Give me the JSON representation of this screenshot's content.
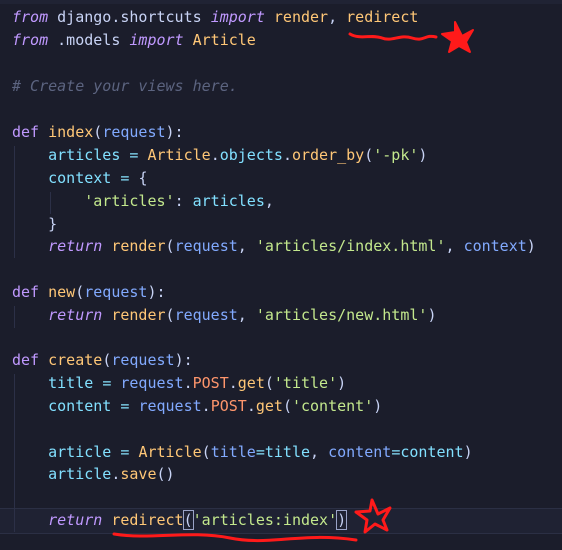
{
  "editor": {
    "lines": {
      "l1": {
        "from": "from",
        "mod": "django.shortcuts",
        "import": "import",
        "a": "render",
        "comma": ",",
        "b": "redirect"
      },
      "l2": {
        "from": "from",
        "mod": ".models",
        "import": "import",
        "a": "Article"
      },
      "l3": {
        "comment": "# Create your views here."
      },
      "l4": {
        "def": "def",
        "name": "index",
        "open": "(",
        "param": "request",
        "close": "):"
      },
      "l5": {
        "var": "articles",
        "eq": "=",
        "cls": "Article",
        "dot1": ".",
        "objects": "objects",
        "dot2": ".",
        "meth": "order_by",
        "open": "(",
        "str": "'-pk'",
        "close": ")"
      },
      "l6": {
        "var": "context",
        "eq": "=",
        "brace": "{"
      },
      "l7": {
        "key": "'articles'",
        "colon": ":",
        "val": "articles",
        "comma": ","
      },
      "l8": {
        "brace": "}"
      },
      "l9": {
        "ret": "return",
        "fn": "render",
        "open": "(",
        "p1": "request",
        "c1": ",",
        "s": "'articles/index.html'",
        "c2": ",",
        "p2": "context",
        "close": ")"
      },
      "l10": {
        "def": "def",
        "name": "new",
        "open": "(",
        "param": "request",
        "close": "):"
      },
      "l11": {
        "ret": "return",
        "fn": "render",
        "open": "(",
        "p1": "request",
        "c1": ",",
        "s": "'articles/new.html'",
        "close": ")"
      },
      "l12": {
        "def": "def",
        "name": "create",
        "open": "(",
        "param": "request",
        "close": "):"
      },
      "l13": {
        "var": "title",
        "eq": "=",
        "req": "request",
        "dot1": ".",
        "post": "POST",
        "dot2": ".",
        "meth": "get",
        "open": "(",
        "s": "'title'",
        "close": ")"
      },
      "l14": {
        "var": "content",
        "eq": "=",
        "req": "request",
        "dot1": ".",
        "post": "POST",
        "dot2": ".",
        "meth": "get",
        "open": "(",
        "s": "'content'",
        "close": ")"
      },
      "l15": {
        "var": "article",
        "eq": "=",
        "cls": "Article",
        "open": "(",
        "k1": "title",
        "e1": "=",
        "v1": "title",
        "c": ",",
        "k2": "content",
        "e2": "=",
        "v2": "content",
        "close": ")"
      },
      "l16": {
        "var": "article",
        "dot": ".",
        "meth": "save",
        "paren": "()"
      },
      "l17": {
        "ret": "return",
        "fn": "redirect",
        "open": "(",
        "s": "'articles:index'",
        "close": ")"
      }
    }
  },
  "colors": {
    "background": "#1b1d2b",
    "annotation": "#ff1a1a"
  }
}
